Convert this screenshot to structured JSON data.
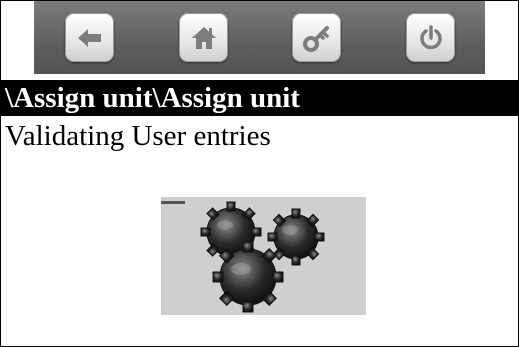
{
  "toolbar": {
    "buttons": [
      {
        "name": "back-button",
        "icon": "back-arrow-icon"
      },
      {
        "name": "home-button",
        "icon": "home-icon"
      },
      {
        "name": "key-button",
        "icon": "key-icon"
      },
      {
        "name": "power-button",
        "icon": "power-icon"
      }
    ],
    "icon_color": "#7d7d7d"
  },
  "header": {
    "breadcrumb": "\\Assign unit\\Assign unit"
  },
  "main": {
    "status_text": "Validating User entries",
    "busy_indicator": "gears-icon"
  }
}
